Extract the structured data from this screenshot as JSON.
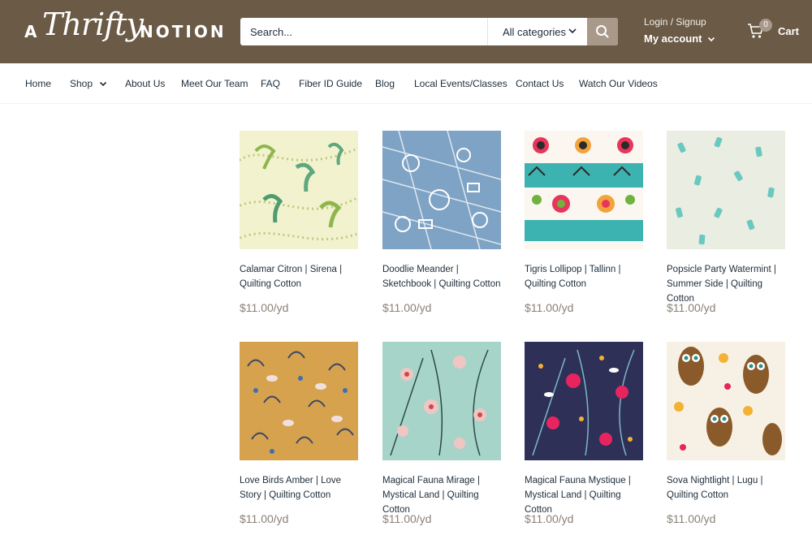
{
  "brand": {
    "a": "A",
    "script": "Thrifty",
    "word": "NOTION"
  },
  "search": {
    "placeholder": "Search...",
    "category": "All categories"
  },
  "account": {
    "login": "Login / Signup",
    "my_account": "My account"
  },
  "cart": {
    "count": "0",
    "label": "Cart"
  },
  "nav": [
    {
      "label": "Home"
    },
    {
      "label": "Shop"
    },
    {
      "label": "About Us"
    },
    {
      "label": "Meet Our Team"
    },
    {
      "label": "FAQ"
    },
    {
      "label": "Fiber ID Guide"
    },
    {
      "label": "Blog"
    },
    {
      "label": "Local Events/Classes"
    },
    {
      "label": "Contact Us"
    },
    {
      "label": "Watch Our Videos"
    }
  ],
  "products": [
    {
      "title": "Calamar Citron | Sirena | Quilting Cotton",
      "price": "$11.00/yd",
      "swatch": "calamar"
    },
    {
      "title": "Doodlie Meander | Sketchbook | Quilting Cotton",
      "price": "$11.00/yd",
      "swatch": "doodle"
    },
    {
      "title": "Tigris Lollipop | Tallinn | Quilting Cotton",
      "price": "$11.00/yd",
      "swatch": "tigris"
    },
    {
      "title": "Popsicle Party Watermint | Summer Side | Quilting Cotton",
      "price": "$11.00/yd",
      "swatch": "popsicle"
    },
    {
      "title": "Love Birds Amber | Love Story | Quilting Cotton",
      "price": "$11.00/yd",
      "swatch": "lovebirds"
    },
    {
      "title": "Magical Fauna Mirage | Mystical Land | Quilting Cotton",
      "price": "$11.00/yd",
      "swatch": "mirage"
    },
    {
      "title": "Magical Fauna Mystique | Mystical Land | Quilting Cotton",
      "price": "$11.00/yd",
      "swatch": "mystique"
    },
    {
      "title": "Sova Nightlight | Lugu | Quilting Cotton",
      "price": "$11.00/yd",
      "swatch": "sova"
    }
  ],
  "colors": {
    "header": "#6b5a45",
    "accent": "#a8998a",
    "text": "#1e2d3b",
    "price": "#8a8176"
  }
}
